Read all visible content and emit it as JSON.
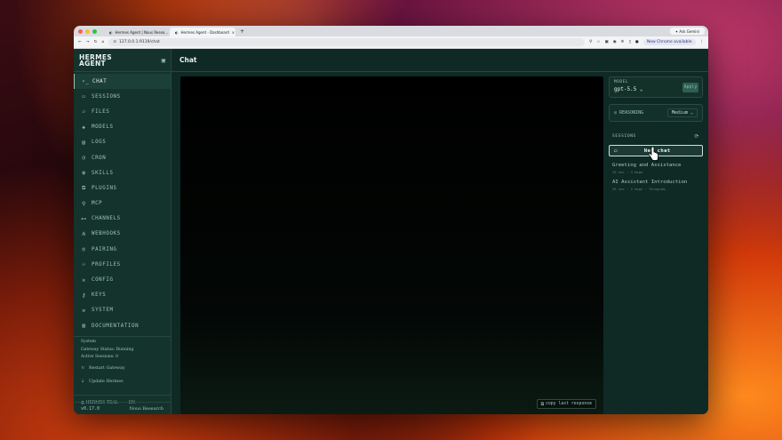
{
  "browser": {
    "tabs": [
      {
        "label": "Hermes Agent | Nous Resea…",
        "active": false
      },
      {
        "label": "Hermes Agent - Dashboard",
        "active": true
      }
    ],
    "ask_label": "Ask Gemini",
    "url": "127.0.0.1:9119/chat",
    "update_label": "New Chrome available"
  },
  "sidebar": {
    "brand_line1": "HERMES",
    "brand_line2": "AGENT",
    "items": [
      {
        "label": "CHAT",
        "icon": "terminal-icon",
        "glyph": "›_",
        "active": true
      },
      {
        "label": "SESSIONS",
        "icon": "chat-bubble-icon",
        "glyph": "▭",
        "active": false
      },
      {
        "label": "FILES",
        "icon": "folder-icon",
        "glyph": "▱",
        "active": false
      },
      {
        "label": "MODELS",
        "icon": "cube-icon",
        "glyph": "◈",
        "active": false
      },
      {
        "label": "LOGS",
        "icon": "file-text-icon",
        "glyph": "▤",
        "active": false
      },
      {
        "label": "CRON",
        "icon": "clock-icon",
        "glyph": "◷",
        "active": false
      },
      {
        "label": "SKILLS",
        "icon": "globe-icon",
        "glyph": "◍",
        "active": false
      },
      {
        "label": "PLUGINS",
        "icon": "puzzle-icon",
        "glyph": "⧉",
        "active": false
      },
      {
        "label": "MCP",
        "icon": "plug-icon",
        "glyph": "⚲",
        "active": false
      },
      {
        "label": "CHANNELS",
        "icon": "radio-icon",
        "glyph": "⊷",
        "active": false
      },
      {
        "label": "WEBHOOKS",
        "icon": "webhook-icon",
        "glyph": "⋔",
        "active": false
      },
      {
        "label": "PAIRING",
        "icon": "shield-icon",
        "glyph": "◎",
        "active": false
      },
      {
        "label": "PROFILES",
        "icon": "users-icon",
        "glyph": "⚇",
        "active": false
      },
      {
        "label": "CONFIG",
        "icon": "gear-icon",
        "glyph": "✲",
        "active": false
      },
      {
        "label": "KEYS",
        "icon": "key-icon",
        "glyph": "⚷",
        "active": false
      },
      {
        "label": "SYSTEM",
        "icon": "wrench-icon",
        "glyph": "⚒",
        "active": false
      },
      {
        "label": "DOCUMENTATION",
        "icon": "book-icon",
        "glyph": "▥",
        "active": false
      }
    ],
    "system_heading": "System",
    "gateway_status": "Gateway Status: Running",
    "active_sessions": "Active Sessions: 0",
    "restart_label": "Restart Gateway",
    "update_label": "Update Hermes",
    "theme_label": "HERMES TEAL",
    "lang_label": "EN",
    "version": "v0.17.0",
    "org": "Nous Research"
  },
  "main": {
    "title": "Chat",
    "copy_label": "copy last response"
  },
  "panel": {
    "model_label": "MODEL",
    "model_value": "gpt-5.5",
    "apply_label": "Apply",
    "reasoning_label": "REASONING",
    "reasoning_value": "Medium",
    "sessions_label": "SESSIONS",
    "new_chat_label": "New chat",
    "sessions": [
      {
        "title": "Greeting and Assistance",
        "meta": "15 sec · 4 msgs"
      },
      {
        "title": "AI Assistant Introduction",
        "meta": "35 sec · 2 msgs · Telegram"
      }
    ]
  },
  "colors": {
    "accent": "#8fc7b9",
    "sidebar_bg": "#14332d",
    "main_bg": "#0f2a25"
  }
}
